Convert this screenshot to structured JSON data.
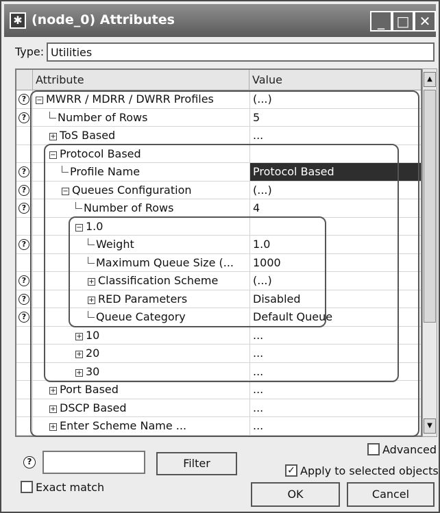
{
  "window": {
    "title": "(node_0) Attributes",
    "minimize": "_",
    "maximize": "□",
    "close": "✕"
  },
  "type": {
    "label": "Type:",
    "value": "Utilities"
  },
  "grid": {
    "col_attribute": "Attribute",
    "col_value": "Value",
    "rows": [
      {
        "name": "MWRR / MDRR / DWRR Profiles",
        "value": "(...)"
      },
      {
        "name": "Number of Rows",
        "value": "5"
      },
      {
        "name": "ToS Based",
        "value": "..."
      },
      {
        "name": "Protocol Based",
        "value": ""
      },
      {
        "name": "Profile Name",
        "value": "Protocol Based"
      },
      {
        "name": "Queues Configuration",
        "value": "(...)"
      },
      {
        "name": "Number of Rows",
        "value": "4"
      },
      {
        "name": "1.0",
        "value": ""
      },
      {
        "name": "Weight",
        "value": "1.0"
      },
      {
        "name": "Maximum Queue Size (...",
        "value": "1000"
      },
      {
        "name": "Classification Scheme",
        "value": "(...)"
      },
      {
        "name": "RED Parameters",
        "value": "Disabled"
      },
      {
        "name": "Queue Category",
        "value": "Default Queue"
      },
      {
        "name": "10",
        "value": "..."
      },
      {
        "name": "20",
        "value": "..."
      },
      {
        "name": "30",
        "value": "..."
      },
      {
        "name": "Port Based",
        "value": "..."
      },
      {
        "name": "DSCP Based",
        "value": "..."
      },
      {
        "name": "Enter Scheme Name ...",
        "value": "..."
      }
    ]
  },
  "icons": {
    "help": "?",
    "expanded": "−",
    "collapsed": "+",
    "scroll_up": "▲",
    "scroll_down": "▼",
    "check": "✓"
  },
  "bottom": {
    "advanced_label": "Advanced",
    "filter_button": "Filter",
    "apply_label": "Apply to selected objects",
    "exact_match_label": "Exact match",
    "ok_button": "OK",
    "cancel_button": "Cancel"
  }
}
